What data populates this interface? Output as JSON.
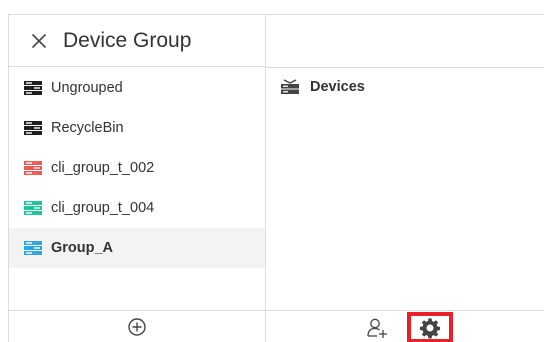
{
  "panel": {
    "title": "Device Group"
  },
  "groups": [
    {
      "label": "Ungrouped",
      "color": "#1f1f1f",
      "selected": false
    },
    {
      "label": "RecycleBin",
      "color": "#1f1f1f",
      "selected": false
    },
    {
      "label": "cli_group_t_002",
      "color": "#ee5a5a",
      "selected": false
    },
    {
      "label": "cli_group_t_004",
      "color": "#22c4a0",
      "selected": false
    },
    {
      "label": "Group_A",
      "color": "#2fa6e0",
      "selected": true
    }
  ],
  "devices": {
    "label": "Devices"
  },
  "icons": {
    "close": "close-icon",
    "add": "add-circle-icon",
    "add_user": "add-user-icon",
    "settings": "gear-icon",
    "devices": "devices-icon",
    "group": "server-group-icon"
  },
  "colors": {
    "highlight_border": "#e8202a",
    "selected_row_bg": "#f3f3f3"
  }
}
